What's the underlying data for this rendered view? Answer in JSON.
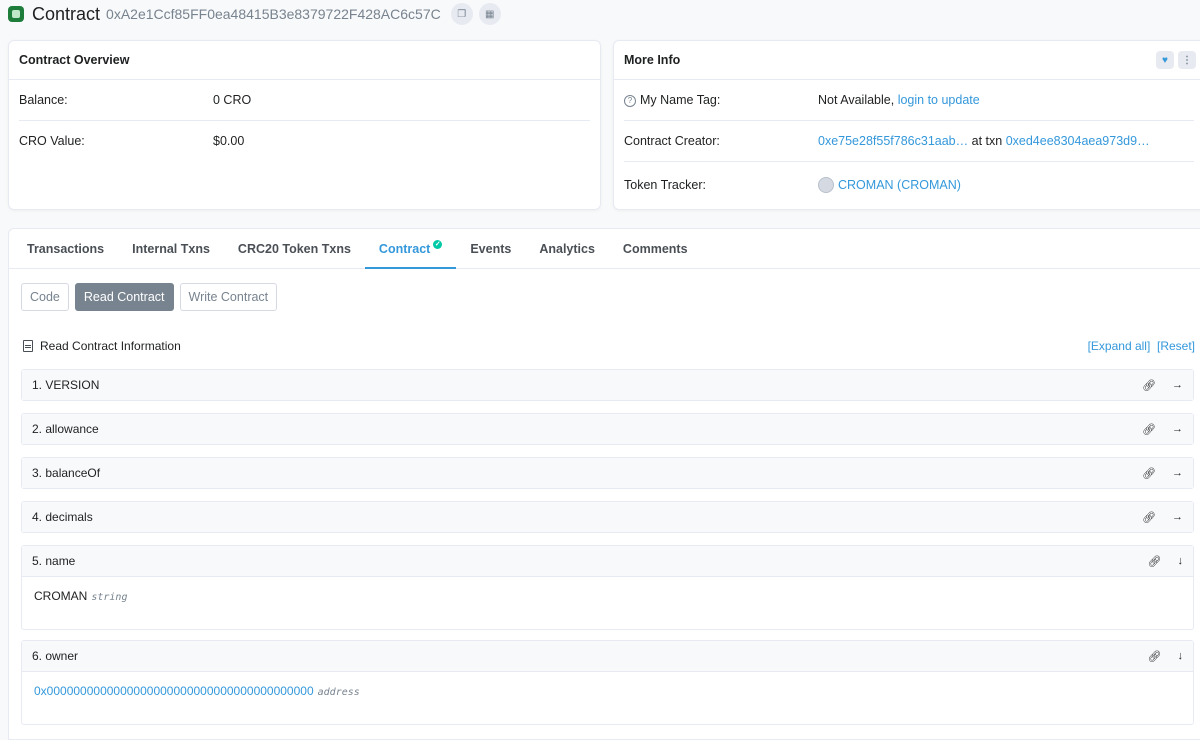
{
  "header": {
    "title": "Contract",
    "address": "0xA2e1Ccf85FF0ea48415B3e8379722F428AC6c57C"
  },
  "overview": {
    "title": "Contract Overview",
    "rows": [
      {
        "label": "Balance:",
        "value": "0 CRO"
      },
      {
        "label": "CRO Value:",
        "value": "$0.00"
      }
    ]
  },
  "more_info": {
    "title": "More Info",
    "name_tag_label": "My Name Tag:",
    "name_tag_value": "Not Available,",
    "name_tag_link": "login to update",
    "creator_label": "Contract Creator:",
    "creator_address": "0xe75e28f55f786c31aab…",
    "creator_at": "at txn",
    "creator_txn": "0xed4ee8304aea973d9…",
    "tracker_label": "Token Tracker:",
    "tracker_value": "CROMAN (CROMAN)"
  },
  "tabs": [
    "Transactions",
    "Internal Txns",
    "CRC20 Token Txns",
    "Contract",
    "Events",
    "Analytics",
    "Comments"
  ],
  "sub_buttons": [
    "Code",
    "Read Contract",
    "Write Contract"
  ],
  "read_info": {
    "title": "Read Contract Information",
    "expand_all": "[Expand all]",
    "reset": "[Reset]"
  },
  "functions": [
    {
      "label": "1. VERSION",
      "expanded": false
    },
    {
      "label": "2. allowance",
      "expanded": false
    },
    {
      "label": "3. balanceOf",
      "expanded": false
    },
    {
      "label": "4. decimals",
      "expanded": false
    },
    {
      "label": "5. name",
      "expanded": true,
      "result": "CROMAN",
      "type": "string"
    },
    {
      "label": "6. owner",
      "expanded": true,
      "result": "0x0000000000000000000000000000000000000000",
      "type": "address"
    }
  ],
  "colors": {
    "accent": "#3498db",
    "success": "#00c9a7",
    "muted": "#77838f"
  }
}
